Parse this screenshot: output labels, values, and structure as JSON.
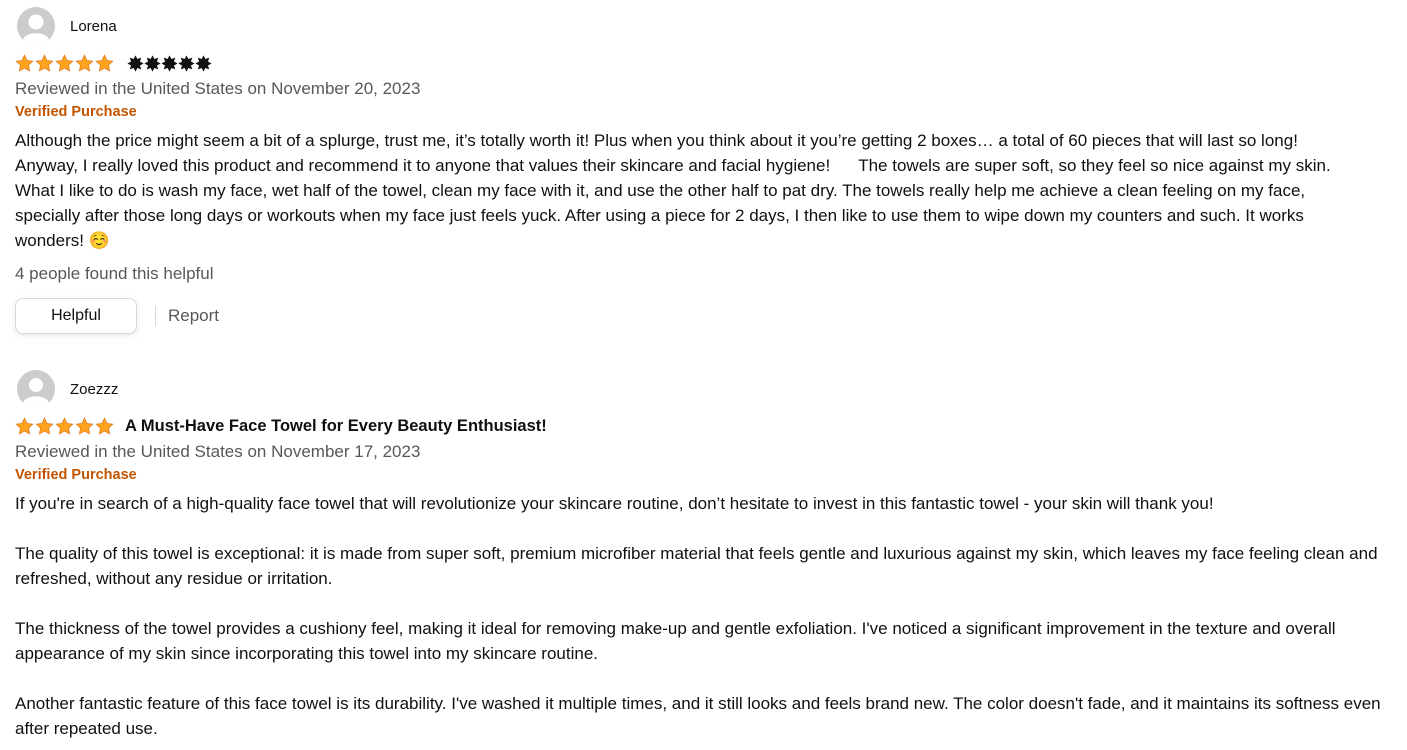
{
  "colors": {
    "star_orange": "#ffa41c",
    "star_outline": "#de7921",
    "verified": "#c45500",
    "secondary_text": "#565959"
  },
  "reviews": [
    {
      "name": "Lorena",
      "rating": 5,
      "has_title": false,
      "image_stars": 5,
      "date": "Reviewed in the United States on November 20, 2023",
      "verified": "Verified Purchase",
      "body_lines": [
        "Although the price might seem a bit of a splurge, trust me, it’s totally worth it! Plus when you think about it you’re getting 2 boxes… a total of 60 pieces that will last so long!",
        "Anyway, I really loved this product and recommend it to anyone that values their skincare and facial hygiene!      The towels are super soft, so they feel so nice against my skin.",
        "What I like to do is wash my face, wet half of the towel, clean my face with it, and use the other half to pat dry. The towels really help me achieve a clean feeling on my face,",
        "specially after those long days or workouts when my face just feels yuck. After using a piece for 2 days, I then like to use them to wipe down my counters and such. It works",
        "wonders! ☺️"
      ],
      "helpful_count": "4 people found this helpful",
      "helpful_button": "Helpful",
      "report_link": "Report"
    },
    {
      "name": "Zoezzz",
      "rating": 5,
      "title": "A Must-Have Face Towel for Every Beauty Enthusiast!",
      "date": "Reviewed in the United States on November 17, 2023",
      "verified": "Verified Purchase",
      "paragraphs": [
        "If you're in search of a high-quality face towel that will revolutionize your skincare routine, don’t hesitate to invest in this fantastic towel - your skin will thank you!",
        "The quality of this towel is exceptional: it is made from super soft, premium microfiber material that feels gentle and luxurious against my skin, which leaves my face feeling clean and refreshed, without any residue or irritation.",
        "The thickness of the towel provides a cushiony feel, making it ideal for removing make-up and gentle exfoliation. I've noticed a significant improvement in the texture and overall appearance of my skin since incorporating this towel into my skincare routine.",
        "Another fantastic feature of this face towel is its durability. I've washed it multiple times, and it still looks and feels brand new. The color doesn't fade, and it maintains its softness even after repeated use."
      ]
    }
  ]
}
